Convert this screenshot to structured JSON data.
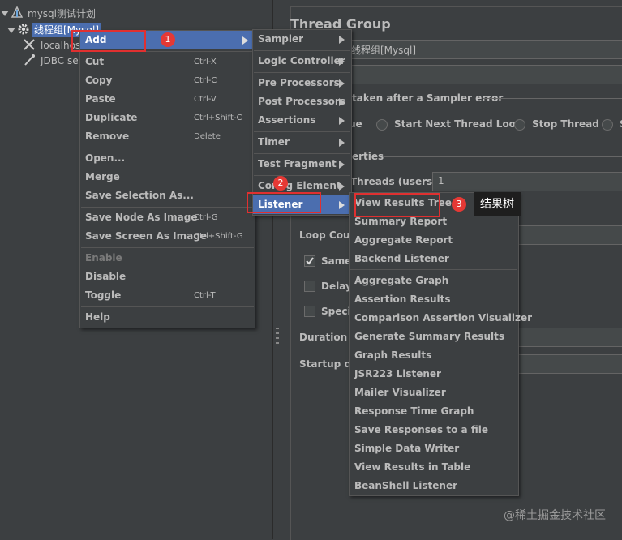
{
  "tree": {
    "root": "mysql测试计划",
    "thread_group": "线程组[Mysql]",
    "child1": "localhos",
    "child2": "JDBC se"
  },
  "panel": {
    "title": "Thread Group",
    "name_value": "线程组[Mysql]",
    "error_label": "taken after a Sampler error",
    "radio_partial": "ue",
    "radio_start_next": "Start Next Thread Loop",
    "radio_stop_thread": "Stop Thread",
    "radio_partial_end": "S",
    "properties": "erties",
    "threads_label": "Threads (users):",
    "threads_value": "1",
    "loop_count": "Loop Coun",
    "same": "Same",
    "delay": "Delay",
    "specify": "Specif",
    "duration": "Duration (s",
    "startup": "Startup del"
  },
  "context_menu": {
    "add": "Add",
    "cut": "Cut",
    "cut_sc": "Ctrl-X",
    "copy": "Copy",
    "copy_sc": "Ctrl-C",
    "paste": "Paste",
    "paste_sc": "Ctrl-V",
    "duplicate": "Duplicate",
    "duplicate_sc": "Ctrl+Shift-C",
    "remove": "Remove",
    "remove_sc": "Delete",
    "open": "Open...",
    "merge": "Merge",
    "save_selection": "Save Selection As...",
    "save_node_image": "Save Node As Image",
    "save_node_image_sc": "Ctrl-G",
    "save_screen_image": "Save Screen As Image",
    "save_screen_image_sc": "Ctrl+Shift-G",
    "enable": "Enable",
    "disable": "Disable",
    "toggle": "Toggle",
    "toggle_sc": "Ctrl-T",
    "help": "Help"
  },
  "add_menu": {
    "sampler": "Sampler",
    "logic_controller": "Logic Controller",
    "pre_processors": "Pre Processors",
    "post_processors": "Post Processors",
    "assertions": "Assertions",
    "timer": "Timer",
    "test_fragment": "Test Fragment",
    "config_element": "Config Element",
    "listener": "Listener"
  },
  "listener_menu": {
    "items_a": [
      "View Results Tree",
      "Summary Report",
      "Aggregate Report",
      "Backend Listener"
    ],
    "items_b": [
      "Aggregate Graph",
      "Assertion Results",
      "Comparison Assertion Visualizer",
      "Generate Summary Results",
      "Graph Results",
      "JSR223 Listener",
      "Mailer Visualizer",
      "Response Time Graph",
      "Save Responses to a file",
      "Simple Data Writer",
      "View Results in Table",
      "BeanShell Listener"
    ]
  },
  "annotations": {
    "badge1": "1",
    "badge2": "2",
    "badge3": "3",
    "tooltip": "结果树",
    "watermark": "@稀土掘金技术社区"
  },
  "colors": {
    "background": "#3c3f41",
    "selection": "#4b6eaf",
    "annotation_red": "#e03030"
  }
}
